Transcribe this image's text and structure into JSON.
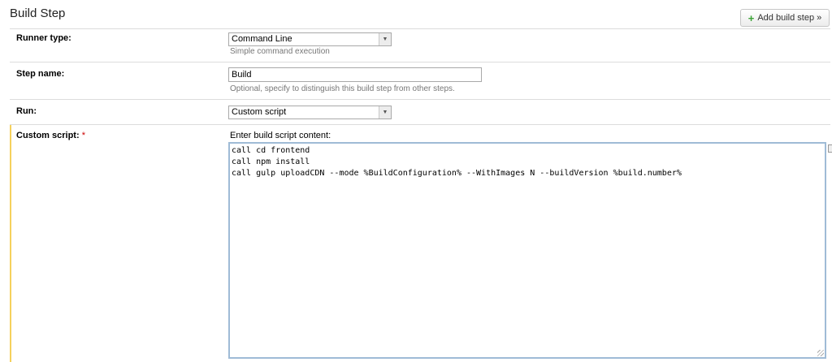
{
  "header": {
    "title": "Build Step",
    "add_button_label": "Add build step »"
  },
  "runner_type": {
    "label": "Runner type:",
    "value": "Command Line",
    "hint": "Simple command execution"
  },
  "step_name": {
    "label": "Step name:",
    "value": "Build",
    "hint": "Optional, specify to distinguish this build step from other steps."
  },
  "run": {
    "label": "Run:",
    "value": "Custom script"
  },
  "custom_script": {
    "label": "Custom script:",
    "required_mark": "*",
    "editor_label": "Enter build script content:",
    "lines": [
      "call cd frontend",
      "call npm install",
      "call gulp uploadCDN --mode %BuildConfiguration% --WithImages N --buildVersion %build.number%"
    ]
  },
  "icons": {
    "add": "plus-icon",
    "dropdown": "chevron-down-icon",
    "resize": "resize-grip-icon"
  },
  "colors": {
    "required": "#cc0000",
    "accent_bar": "#f5d15c",
    "add_icon": "#3aa335"
  }
}
